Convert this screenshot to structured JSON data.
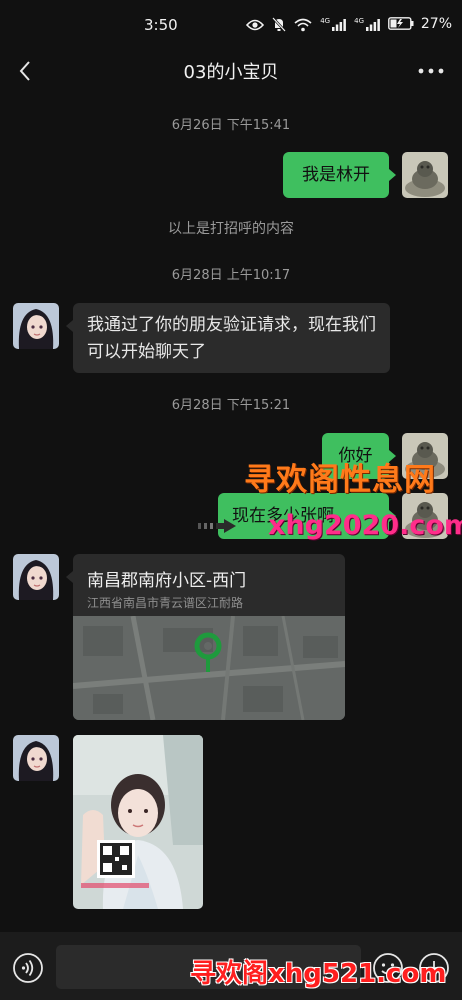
{
  "status_bar": {
    "time": "3:50",
    "network_1": "4G",
    "network_2": "4G",
    "battery_percent": "27%",
    "icons": [
      "eye-icon",
      "mute-bell-icon",
      "wifi-icon",
      "signal-icon",
      "signal-icon",
      "battery-icon"
    ]
  },
  "header": {
    "title": "03的小宝贝",
    "back_icon": "chevron-left-icon",
    "more_icon": "more-dots-icon"
  },
  "messages": {
    "ts1": "6月26日 下午15:41",
    "me_1": "我是林开",
    "system_1": "以上是打招呼的内容",
    "ts2": "6月28日 上午10:17",
    "other_1": "我通过了你的朋友验证请求，现在我们可以开始聊天了",
    "ts3": "6月28日 下午15:21",
    "me_2": "你好",
    "me_3": "现在多少张啊"
  },
  "location": {
    "name": "南昌郡南府小区-西门",
    "address": "江西省南昌市青云谱区江耐路"
  },
  "watermarks": {
    "top_cn": "寻欢阁性息网",
    "top_url": "xhg2020.com",
    "bottom": "寻欢阁xhg521.com"
  },
  "input_bar": {
    "placeholder": "",
    "voice_icon": "voice-icon",
    "emoji_icon": "emoji-icon",
    "plus_icon": "plus-icon"
  },
  "colors": {
    "background": "#111111",
    "bubble_me": "#3fbf5f",
    "bubble_other": "#2b2b2b",
    "watermark_orange": "#ff7a1a",
    "watermark_pink": "#ff2d8a",
    "watermark_red": "#ff1f1f"
  }
}
